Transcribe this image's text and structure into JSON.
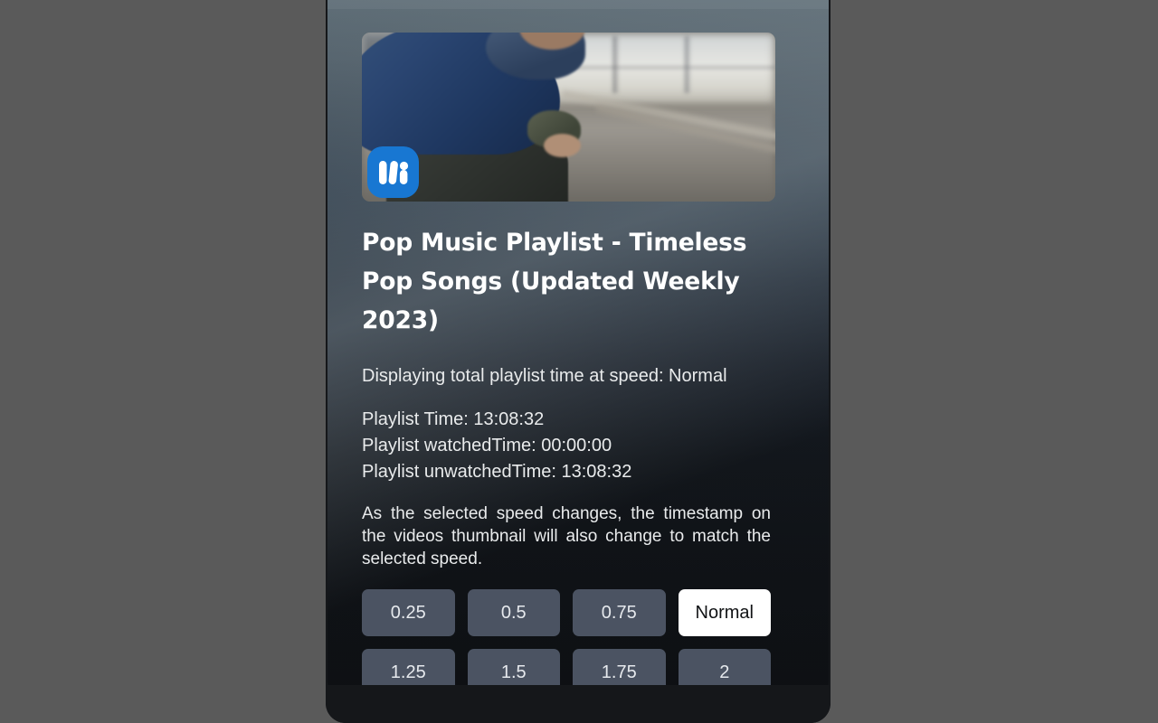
{
  "theme": {
    "page_background": "#5a5a5a",
    "frame_background": "#15171a",
    "panel_gradient_top": "#5f6e77",
    "panel_gradient_bottom": "#0d0f12",
    "button_background": "#4b5362",
    "button_text": "#e6e9ed",
    "button_active_background": "#ffffff",
    "button_active_text": "#101214",
    "title_color": "#ffffff",
    "body_text_color": "#e9ebec",
    "logo_badge_color": "#1877d2",
    "scrollbar_track": "#f1f1f1",
    "scrollbar_thumb": "#c2c2c2",
    "scrollbar_arrow": "#4d4d4d"
  },
  "thumbnail": {
    "alt": "Person in blue jacket sitting beside railway tracks at dusk",
    "logo_icon": "warner-music-logo-icon",
    "logo_label": "W"
  },
  "video": {
    "title": "Pop Music Playlist - Timeless Pop Songs (Updated Weekly 2023)"
  },
  "speed_summary": {
    "text": "Displaying total playlist time at speed: Normal"
  },
  "times": {
    "playlist_time_label": "Playlist Time:",
    "playlist_time_value": "13:08:32",
    "watched_time_label": "Playlist watchedTime:",
    "watched_time_value": "00:00:00",
    "unwatched_time_label": "Playlist unwatchedTime:",
    "unwatched_time_value": "13:08:32",
    "playlist_time_line": "Playlist Time: 13:08:32",
    "watched_time_line": "Playlist watchedTime: 00:00:00",
    "unwatched_time_line": "Playlist unwatchedTime: 13:08:32"
  },
  "note": {
    "text": "As the selected speed changes, the timestamp on the videos thumbnail will also change to match the selected speed."
  },
  "speed_options": [
    {
      "label": "0.25",
      "selected": false
    },
    {
      "label": "0.5",
      "selected": false
    },
    {
      "label": "0.75",
      "selected": false
    },
    {
      "label": "Normal",
      "selected": true
    },
    {
      "label": "1.25",
      "selected": false
    },
    {
      "label": "1.5",
      "selected": false
    },
    {
      "label": "1.75",
      "selected": false
    },
    {
      "label": "2",
      "selected": false
    }
  ],
  "scrollbar": {
    "up_arrow_icon": "triangle-up-icon",
    "down_arrow_icon": "triangle-down-icon",
    "thumb_name": "scrollbar-thumb"
  }
}
